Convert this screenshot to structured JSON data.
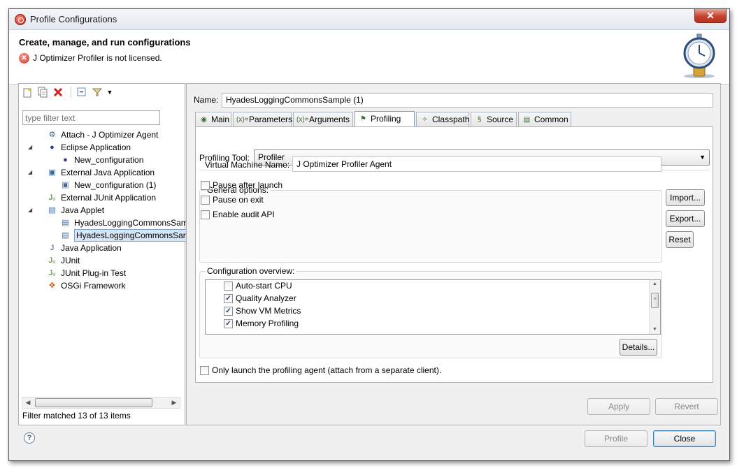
{
  "window": {
    "title": "Profile Configurations",
    "close_glyph": "✕"
  },
  "header": {
    "title": "Create, manage, and run configurations",
    "error_text": "J Optimizer Profiler is not licensed.",
    "error_glyph": "✕"
  },
  "left": {
    "filter_placeholder": "type filter text",
    "tree": [
      {
        "label": "Attach - J Optimizer Agent",
        "icon": "attach-icon",
        "depth": 0,
        "twist": ""
      },
      {
        "label": "Eclipse Application",
        "icon": "eclipse-icon",
        "depth": 0,
        "twist": "◢"
      },
      {
        "label": "New_configuration",
        "icon": "eclipse-icon",
        "depth": 1,
        "twist": ""
      },
      {
        "label": "External Java Application",
        "icon": "external-java-icon",
        "depth": 0,
        "twist": "◢"
      },
      {
        "label": "New_configuration (1)",
        "icon": "external-java-icon",
        "depth": 1,
        "twist": ""
      },
      {
        "label": "External JUnit Application",
        "icon": "junit-icon",
        "depth": 0,
        "twist": ""
      },
      {
        "label": "Java Applet",
        "icon": "applet-icon",
        "depth": 0,
        "twist": "◢"
      },
      {
        "label": "HyadesLoggingCommonsSamp",
        "icon": "applet-icon",
        "depth": 1,
        "twist": ""
      },
      {
        "label": "HyadesLoggingCommonsSamp",
        "icon": "applet-icon",
        "depth": 1,
        "twist": "",
        "selected": true
      },
      {
        "label": "Java Application",
        "icon": "java-app-icon",
        "depth": 0,
        "twist": ""
      },
      {
        "label": "JUnit",
        "icon": "junit-icon",
        "depth": 0,
        "twist": ""
      },
      {
        "label": "JUnit Plug-in Test",
        "icon": "junit-plugin-icon",
        "depth": 0,
        "twist": ""
      },
      {
        "label": "OSGi Framework",
        "icon": "osgi-icon",
        "depth": 0,
        "twist": ""
      }
    ],
    "status": "Filter matched 13 of 13 items"
  },
  "right": {
    "name_label": "Name:",
    "name_value": "HyadesLoggingCommonsSample (1)",
    "tabs": [
      {
        "label": "Main",
        "icon": "main-tab-icon",
        "glyph": "◉"
      },
      {
        "label": "Parameters",
        "icon": "parameters-icon",
        "glyph": "(x)="
      },
      {
        "label": "Arguments",
        "icon": "arguments-icon",
        "glyph": "(x)="
      },
      {
        "label": "Profiling",
        "icon": "profiling-icon",
        "glyph": "⚑",
        "active": true
      },
      {
        "label": "Classpath",
        "icon": "classpath-icon",
        "glyph": "✧"
      },
      {
        "label": "Source",
        "icon": "source-icon",
        "glyph": "§"
      },
      {
        "label": "Common",
        "icon": "common-icon",
        "glyph": "▤"
      }
    ],
    "profiling_tool_label": "Profiling Tool:",
    "profiling_tool_value": "Profiler",
    "general_options": {
      "legend": "General options:",
      "vm_label": "Virtual Machine Name:",
      "vm_value": "J Optimizer Profiler Agent",
      "checkboxes": [
        {
          "label": "Pause after launch",
          "checked": false
        },
        {
          "label": "Pause on exit",
          "checked": false
        },
        {
          "label": "Enable audit API",
          "checked": false
        }
      ]
    },
    "side_buttons": [
      "Import...",
      "Export...",
      "Reset"
    ],
    "overview": {
      "legend": "Configuration overview:",
      "items": [
        {
          "label": "Auto-start CPU",
          "checked": false
        },
        {
          "label": "Quality Analyzer",
          "checked": true
        },
        {
          "label": "Show VM Metrics",
          "checked": true
        },
        {
          "label": "Memory Profiling",
          "checked": true
        }
      ],
      "details_button": "Details..."
    },
    "only_launch_label": "Only launch the profiling agent (attach from a separate client).",
    "apply_button": "Apply",
    "revert_button": "Revert"
  },
  "footer": {
    "profile_button": "Profile",
    "close_button": "Close",
    "help_glyph": "?"
  }
}
